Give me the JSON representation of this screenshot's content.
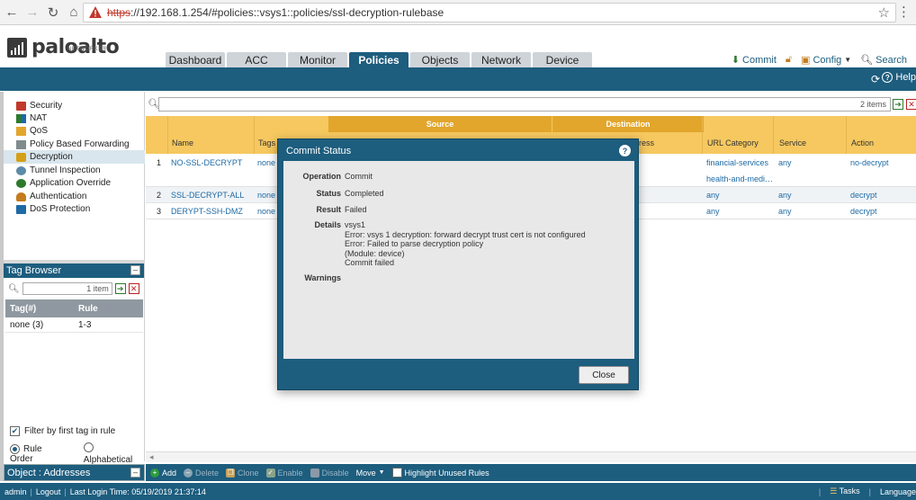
{
  "browser": {
    "url_scheme": "https",
    "url_rest": "://192.168.1.254/#policies::vsys1::policies/ssl-decryption-rulebase"
  },
  "app": {
    "logo_name": "paloalto",
    "logo_sub": "NETWORKS®",
    "tabs": [
      {
        "label": "Dashboard",
        "active": false
      },
      {
        "label": "ACC",
        "active": false
      },
      {
        "label": "Monitor",
        "active": false
      },
      {
        "label": "Policies",
        "active": true
      },
      {
        "label": "Objects",
        "active": false
      },
      {
        "label": "Network",
        "active": false
      },
      {
        "label": "Device",
        "active": false
      }
    ],
    "actions": {
      "commit": "Commit",
      "config": "Config",
      "search": "Search"
    },
    "help_label": "Help"
  },
  "sidebar": {
    "items": [
      {
        "label": "Security",
        "active": false,
        "icon": "security-icon"
      },
      {
        "label": "NAT",
        "active": false,
        "icon": "nat-icon"
      },
      {
        "label": "QoS",
        "active": false,
        "icon": "qos-icon"
      },
      {
        "label": "Policy Based Forwarding",
        "active": false,
        "icon": "pbf-icon"
      },
      {
        "label": "Decryption",
        "active": true,
        "icon": "lock-icon"
      },
      {
        "label": "Tunnel Inspection",
        "active": false,
        "icon": "tunnel-icon"
      },
      {
        "label": "Application Override",
        "active": false,
        "icon": "override-icon"
      },
      {
        "label": "Authentication",
        "active": false,
        "icon": "user-icon"
      },
      {
        "label": "DoS Protection",
        "active": false,
        "icon": "dos-icon"
      }
    ]
  },
  "tag_browser": {
    "title": "Tag Browser",
    "search_count": "1 item",
    "columns": [
      "Tag(#)",
      "Rule"
    ],
    "rows": [
      [
        "none (3)",
        "1-3"
      ]
    ],
    "filter_label": "Filter by first tag in rule",
    "rule_order_label": "Rule Order",
    "alphabetical_label": "Alphabetical"
  },
  "object_panel": {
    "label": "Object : Addresses"
  },
  "rulebase": {
    "search_count": "2 items",
    "group_headers": {
      "source": "Source",
      "destination": "Destination"
    },
    "columns": {
      "name": "Name",
      "tags": "Tags",
      "ress": "ress",
      "url_category": "URL Category",
      "service": "Service",
      "action": "Action"
    },
    "rules": [
      {
        "num": "1",
        "name": "NO-SSL-DECRYPT",
        "tags": "none",
        "url_category": [
          "financial-services",
          "health-and-medi…"
        ],
        "service": "any",
        "action": "no-decrypt"
      },
      {
        "num": "2",
        "name": "SSL-DECRYPT-ALL",
        "tags": "none",
        "url_category": [
          "any"
        ],
        "service": "any",
        "action": "decrypt"
      },
      {
        "num": "3",
        "name": "DERYPT-SSH-DMZ",
        "tags": "none",
        "url_category": [
          "any"
        ],
        "service": "any",
        "action": "decrypt"
      }
    ]
  },
  "bottom_toolbar": {
    "add": "Add",
    "delete": "Delete",
    "clone": "Clone",
    "enable": "Enable",
    "disable": "Disable",
    "move": "Move",
    "highlight": "Highlight Unused Rules"
  },
  "status_bar": {
    "user": "admin",
    "logout": "Logout",
    "last_login": "Last Login Time: 05/19/2019 21:37:14",
    "tasks": "Tasks",
    "language": "Language"
  },
  "modal": {
    "title": "Commit Status",
    "operation_label": "Operation",
    "operation_value": "Commit",
    "status_label": "Status",
    "status_value": "Completed",
    "result_label": "Result",
    "result_value": "Failed",
    "details_label": "Details",
    "details_lines": [
      "vsys1",
      "Error: vsys 1 decryption: forward decrypt trust cert is not configured",
      "Error: Failed to parse decryption policy",
      "(Module: device)",
      "Commit failed"
    ],
    "warnings_label": "Warnings",
    "close_label": "Close"
  }
}
